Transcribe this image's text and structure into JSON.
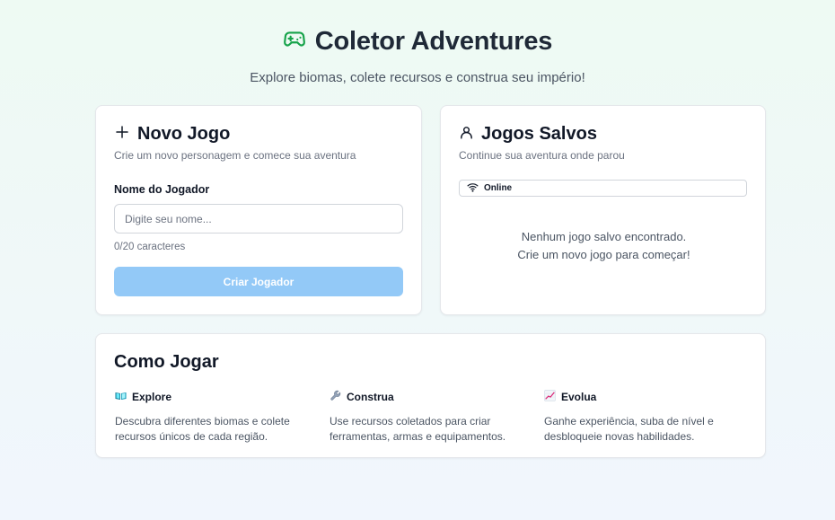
{
  "header": {
    "icon": "gamepad-icon",
    "title": "Coletor Adventures",
    "subtitle": "Explore biomas, colete recursos e construa seu império!"
  },
  "new_game": {
    "icon": "plus-icon",
    "title": "Novo Jogo",
    "description": "Crie um novo personagem e comece sua aventura",
    "field_label": "Nome do Jogador",
    "input_value": "",
    "input_placeholder": "Digite seu nome...",
    "counter": "0/20 caracteres",
    "create_button": "Criar Jogador"
  },
  "saved_games": {
    "icon": "user-icon",
    "title": "Jogos Salvos",
    "description": "Continue sua aventura onde parou",
    "status_icon": "wifi-icon",
    "status": "Online",
    "empty_line1": "Nenhum jogo salvo encontrado.",
    "empty_line2": "Crie um novo jogo para começar!"
  },
  "how_to_play": {
    "title": "Como Jogar",
    "items": [
      {
        "icon": "book-icon",
        "title": "Explore",
        "text": "Descubra diferentes biomas e colete recursos únicos de cada região."
      },
      {
        "icon": "wrench-icon",
        "title": "Construa",
        "text": "Use recursos coletados para criar ferramentas, armas e equipamentos."
      },
      {
        "icon": "chart-icon",
        "title": "Evolua",
        "text": "Ganhe experiência, suba de nível e desbloqueie novas habilidades."
      }
    ]
  },
  "colors": {
    "accent": "#16a34a",
    "button_disabled": "#93c9f7",
    "text_dark": "#111827",
    "text_muted": "#6b7280"
  }
}
